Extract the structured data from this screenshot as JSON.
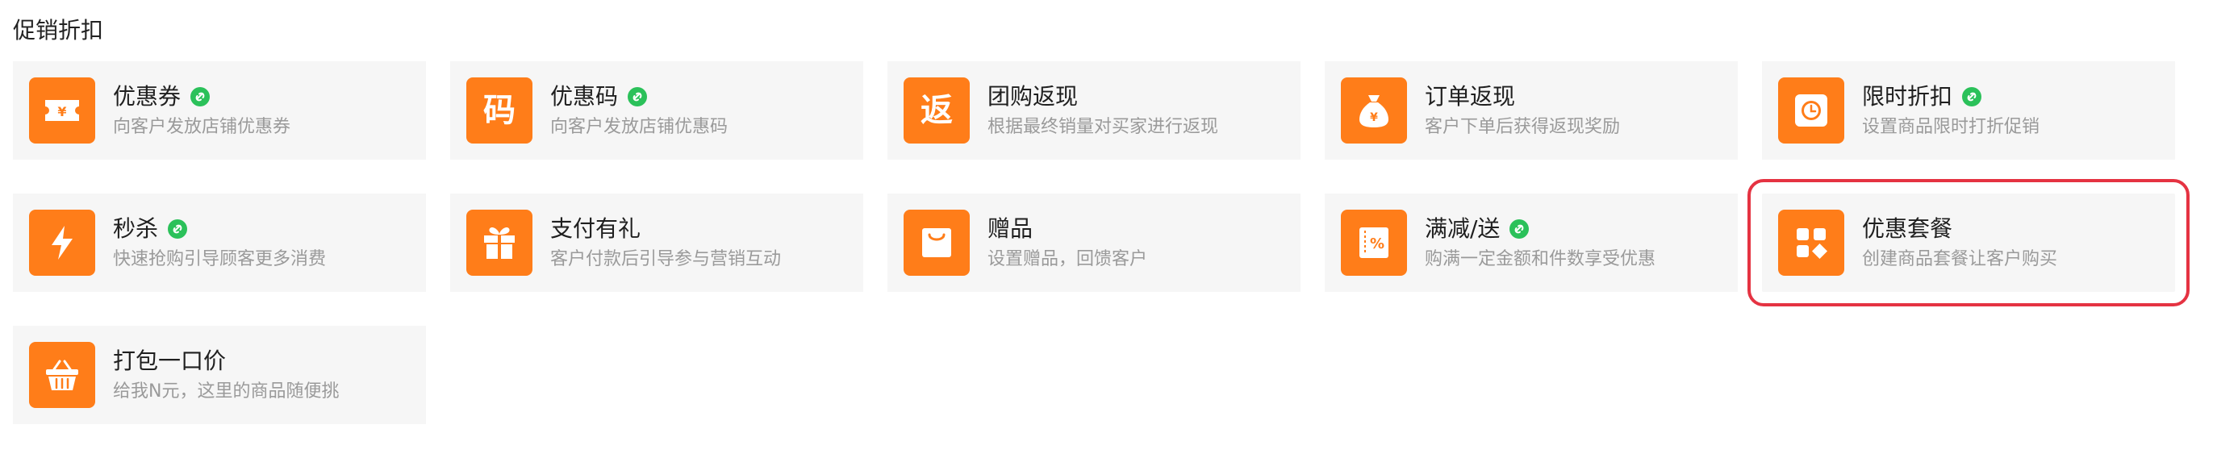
{
  "section": {
    "title": "促销折扣"
  },
  "colors": {
    "accent": "#ff7d19",
    "badge": "#2bc15a",
    "highlight": "#e53342",
    "card_bg": "#f6f6f6"
  },
  "cards": [
    {
      "title": "优惠券",
      "desc": "向客户发放店铺优惠券",
      "icon": "coupon-icon",
      "badge": true
    },
    {
      "title": "优惠码",
      "desc": "向客户发放店铺优惠码",
      "icon": "code-icon",
      "glyph": "码",
      "badge": true
    },
    {
      "title": "团购返现",
      "desc": "根据最终销量对买家进行返现",
      "icon": "return-icon",
      "glyph": "返",
      "badge": false
    },
    {
      "title": "订单返现",
      "desc": "客户下单后获得返现奖励",
      "icon": "money-bag-icon",
      "badge": false
    },
    {
      "title": "限时折扣",
      "desc": "设置商品限时打折促销",
      "icon": "clock-icon",
      "badge": true
    },
    {
      "title": "秒杀",
      "desc": "快速抢购引导顾客更多消费",
      "icon": "lightning-icon",
      "badge": true
    },
    {
      "title": "支付有礼",
      "desc": "客户付款后引导参与营销互动",
      "icon": "gift-icon",
      "badge": false
    },
    {
      "title": "赠品",
      "desc": "设置赠品，回馈客户",
      "icon": "shopping-bag-icon",
      "badge": false
    },
    {
      "title": "满减/送",
      "desc": "购满一定金额和件数享受优惠",
      "icon": "percent-ticket-icon",
      "badge": true
    },
    {
      "title": "优惠套餐",
      "desc": "创建商品套餐让客户购买",
      "icon": "package-icon",
      "badge": false,
      "highlighted": true
    },
    {
      "title": "打包一口价",
      "desc": "给我N元，这里的商品随便挑",
      "icon": "basket-icon",
      "badge": false
    }
  ]
}
